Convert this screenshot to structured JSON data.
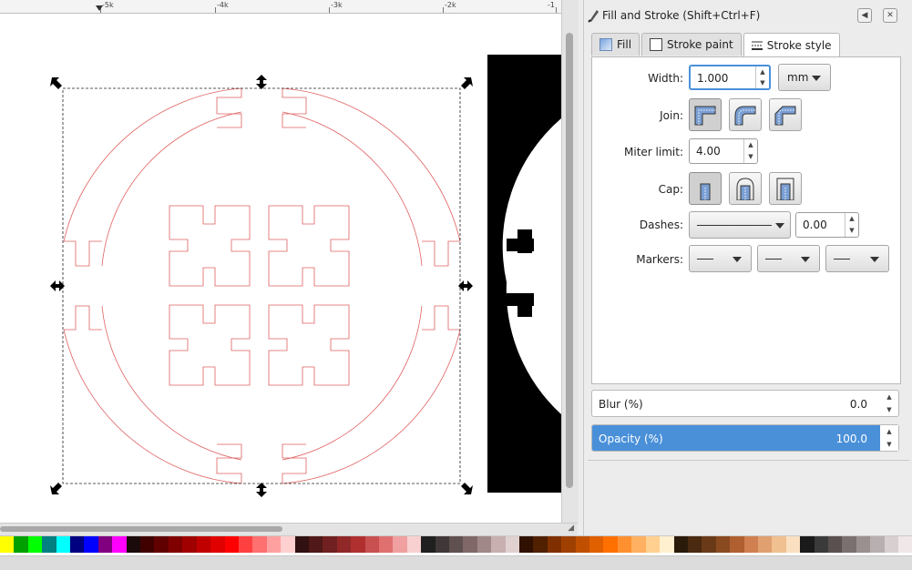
{
  "ruler": {
    "labels": [
      {
        "text": "-5k",
        "pos": "left"
      },
      {
        "text": "-4k",
        "pos": "mid1"
      },
      {
        "text": "-3k",
        "pos": "mid2"
      },
      {
        "text": "-2k",
        "pos": "mid3"
      },
      {
        "text": "-1",
        "pos": "right"
      }
    ]
  },
  "panel": {
    "title": "Fill and Stroke (Shift+Ctrl+F)",
    "tabs": [
      {
        "label": "Fill",
        "icon": "fill-gradient-icon"
      },
      {
        "label": "Stroke paint",
        "icon": "stroke-paint-icon"
      },
      {
        "label": "Stroke style",
        "icon": "stroke-style-icon"
      }
    ],
    "active_tab": "Stroke style",
    "width_label": "Width:",
    "width_value": "1.000",
    "unit": "mm",
    "join_label": "Join:",
    "miter_label": "Miter limit:",
    "miter_value": "4.00",
    "cap_label": "Cap:",
    "dashes_label": "Dashes:",
    "dash_offset": "0.00",
    "markers_label": "Markers:",
    "blur_label": "Blur (%)",
    "blur_value": "0.0",
    "opacity_label": "Opacity (%)",
    "opacity_value": "100.0",
    "opacity_fraction": 1.0
  },
  "colors": {
    "accent": "#4a90d9",
    "stroke_red": "#e06060",
    "palette": [
      "#ffff00",
      "#00a000",
      "#00ff00",
      "#008080",
      "#00ffff",
      "#000080",
      "#0000ff",
      "#800080",
      "#ff00ff",
      "#1a0a0a",
      "#400000",
      "#600000",
      "#800000",
      "#a00000",
      "#c00000",
      "#e00000",
      "#ff0000",
      "#ff4040",
      "#ff7070",
      "#ffa0a0",
      "#ffd0d0",
      "#301010",
      "#501818",
      "#702020",
      "#902828",
      "#b03030",
      "#c85050",
      "#e07070",
      "#f0a0a0",
      "#f8d0d0",
      "#202020",
      "#403838",
      "#605050",
      "#806868",
      "#a08888",
      "#c8b0b0",
      "#e0d0d0",
      "#301000",
      "#502000",
      "#803000",
      "#a04000",
      "#c05000",
      "#e06000",
      "#ff7000",
      "#ff9030",
      "#ffb060",
      "#ffd090",
      "#fff0d0",
      "#2a1a0a",
      "#4a2a10",
      "#6a3a18",
      "#8a4a20",
      "#b06030",
      "#d08050",
      "#e0a070",
      "#f0c090",
      "#fae0c0",
      "#1a1a1a",
      "#3a3a3a",
      "#5a5050",
      "#7a7070",
      "#9a9090",
      "#b8b0b0",
      "#d8d0d0",
      "#f0e8e8"
    ]
  }
}
